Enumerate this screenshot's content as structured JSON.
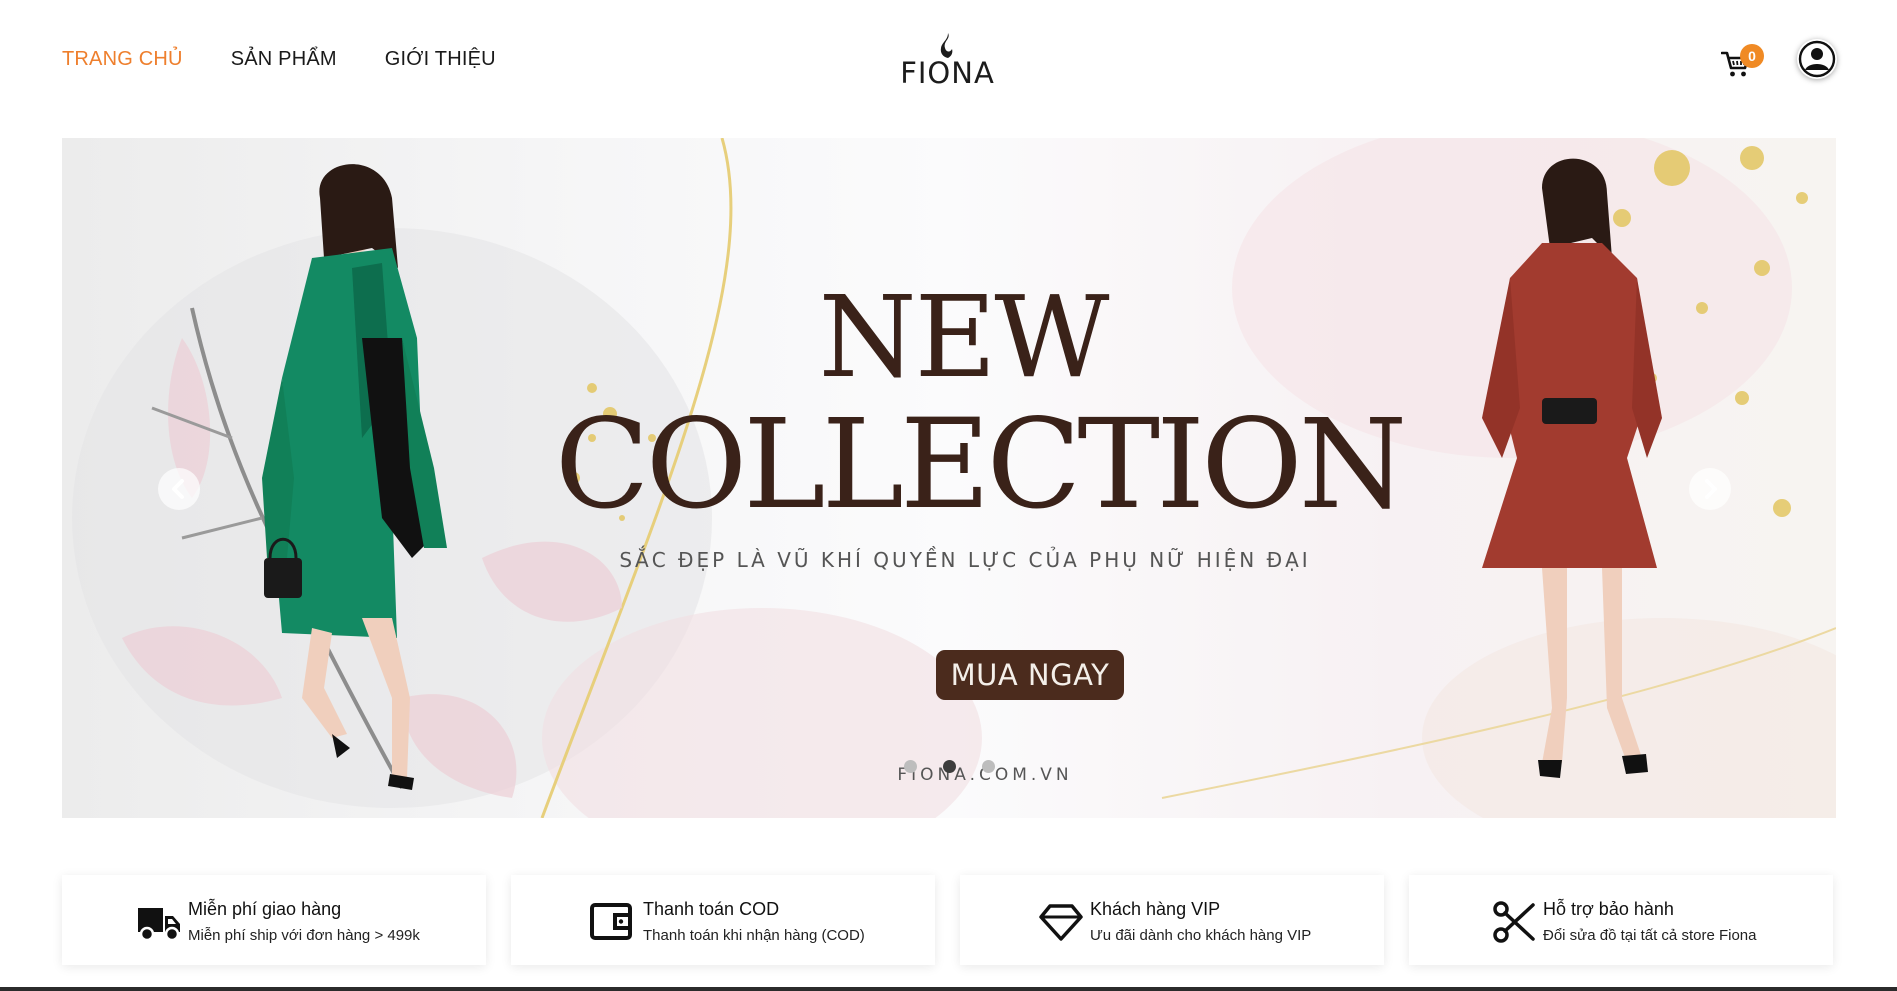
{
  "nav": {
    "items": [
      {
        "label": "TRANG CHỦ",
        "active": true
      },
      {
        "label": "SẢN PHẨM",
        "active": false
      },
      {
        "label": "GIỚI THIỆU",
        "active": false
      }
    ]
  },
  "logo": {
    "text": "FIONA"
  },
  "cart": {
    "count": "0"
  },
  "hero": {
    "headline_line1": "NEW",
    "headline_line2": "COLLECTION",
    "tagline": "SẮC ĐẸP LÀ VŨ KHÍ QUYỀN LỰC CỦA PHỤ NỮ HIỆN ĐẠI",
    "cta_label": "MUA NGAY",
    "site": "FIONA.COM.VN",
    "slide_count": 3,
    "active_slide": 2
  },
  "features": [
    {
      "icon": "truck-icon",
      "title": "Miễn phí giao hàng",
      "subtitle": "Miễn phí ship với đơn hàng > 499k"
    },
    {
      "icon": "wallet-icon",
      "title": "Thanh toán COD",
      "subtitle": "Thanh toán khi nhận hàng (COD)"
    },
    {
      "icon": "diamond-icon",
      "title": "Khách hàng VIP",
      "subtitle": "Ưu đãi dành cho khách hàng VIP"
    },
    {
      "icon": "scissors-icon",
      "title": "Hỗ trợ bảo hành",
      "subtitle": "Đổi sửa đồ tại tất cả store Fiona"
    }
  ],
  "colors": {
    "accent": "#ee7f2d",
    "badge": "#f08a24",
    "brand_brown": "#3a2219",
    "cta_bg": "#4b2b1d",
    "green_coat": "#138a63",
    "red_dress": "#a23b2f"
  }
}
